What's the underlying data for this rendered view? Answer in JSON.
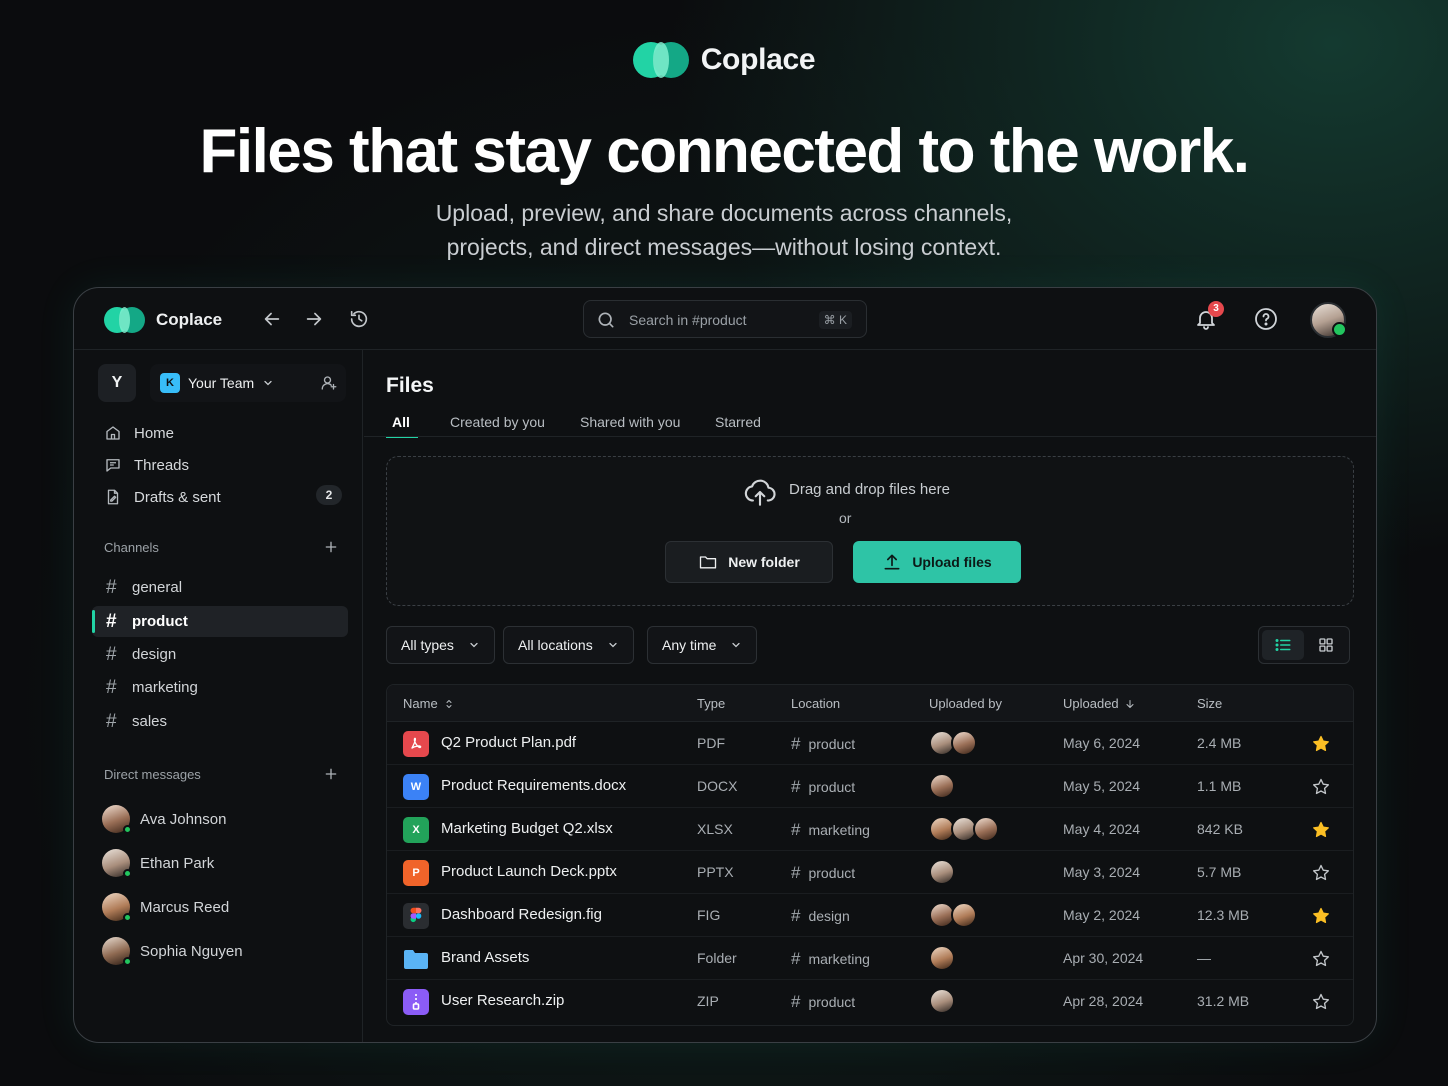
{
  "hero": {
    "brand": "Coplace",
    "title": "Files that stay connected to the work.",
    "subtitle_line1": "Upload, preview, and share documents across channels,",
    "subtitle_line2": "projects, and direct messages—without losing context."
  },
  "topbar": {
    "app_name": "Coplace",
    "search_placeholder": "Search in #product",
    "search_shortcut": "⌘ K",
    "notification_count": "3"
  },
  "sidebar": {
    "workspace_initial": "Y",
    "team_name": "Your Team",
    "team_icon": "K",
    "nav": [
      {
        "label": "Home",
        "icon": "home-icon"
      },
      {
        "label": "Threads",
        "icon": "threads-icon"
      },
      {
        "label": "Drafts & sent",
        "icon": "drafts-icon",
        "count": "2"
      }
    ],
    "channels_title": "Channels",
    "channels": [
      "general",
      "product",
      "design",
      "marketing",
      "sales"
    ],
    "active_channel": "product",
    "dms_title": "Direct messages",
    "dms": [
      "Ava Johnson",
      "Ethan Park",
      "Marcus Reed",
      "Sophia Nguyen"
    ]
  },
  "files": {
    "title": "Files",
    "tabs": [
      "All",
      "Created by you",
      "Shared with you",
      "Starred"
    ],
    "active_tab": "All",
    "dropzone": {
      "text": "Drag and drop files here",
      "or": "or",
      "new_folder": "New folder",
      "upload": "Upload files"
    },
    "filters": [
      "All types",
      "All locations",
      "Any time"
    ],
    "columns": {
      "name": "Name",
      "type": "Type",
      "location": "Location",
      "uploaded_by": "Uploaded by",
      "uploaded": "Uploaded",
      "size": "Size"
    },
    "rows": [
      {
        "name": "Q2 Product Plan.pdf",
        "type": "PDF",
        "location": "product",
        "uploaders": 2,
        "date": "May 6, 2024",
        "size": "2.4 MB",
        "starred": true,
        "icon": "pdf-icon",
        "color": "#e5484d"
      },
      {
        "name": "Product Requirements.docx",
        "type": "DOCX",
        "location": "product",
        "uploaders": 1,
        "date": "May 5, 2024",
        "size": "1.1 MB",
        "starred": false,
        "icon": "word-icon",
        "color": "#3b82f6"
      },
      {
        "name": "Marketing Budget Q2.xlsx",
        "type": "XLSX",
        "location": "marketing",
        "uploaders": 3,
        "date": "May 4, 2024",
        "size": "842 KB",
        "starred": true,
        "icon": "excel-icon",
        "color": "#22a35a"
      },
      {
        "name": "Product Launch Deck.pptx",
        "type": "PPTX",
        "location": "product",
        "uploaders": 1,
        "date": "May 3, 2024",
        "size": "5.7 MB",
        "starred": false,
        "icon": "powerpoint-icon",
        "color": "#f0642a"
      },
      {
        "name": "Dashboard Redesign.fig",
        "type": "FIG",
        "location": "design",
        "uploaders": 2,
        "date": "May 2, 2024",
        "size": "12.3 MB",
        "starred": true,
        "icon": "figma-icon",
        "color": "#2a2d31"
      },
      {
        "name": "Brand Assets",
        "type": "Folder",
        "location": "marketing",
        "uploaders": 1,
        "date": "Apr 30, 2024",
        "size": "—",
        "starred": false,
        "icon": "folder-icon",
        "color": "#4aa8f0"
      },
      {
        "name": "User Research.zip",
        "type": "ZIP",
        "location": "product",
        "uploaders": 1,
        "date": "Apr 28, 2024",
        "size": "31.2 MB",
        "starred": false,
        "icon": "zip-icon",
        "color": "#8b5cf6"
      }
    ]
  },
  "colors": {
    "accent": "#22d3a5",
    "primary_button": "#2ec4a6",
    "star": "#fbbf24",
    "badge": "#e5484d",
    "online": "#22c55e"
  }
}
